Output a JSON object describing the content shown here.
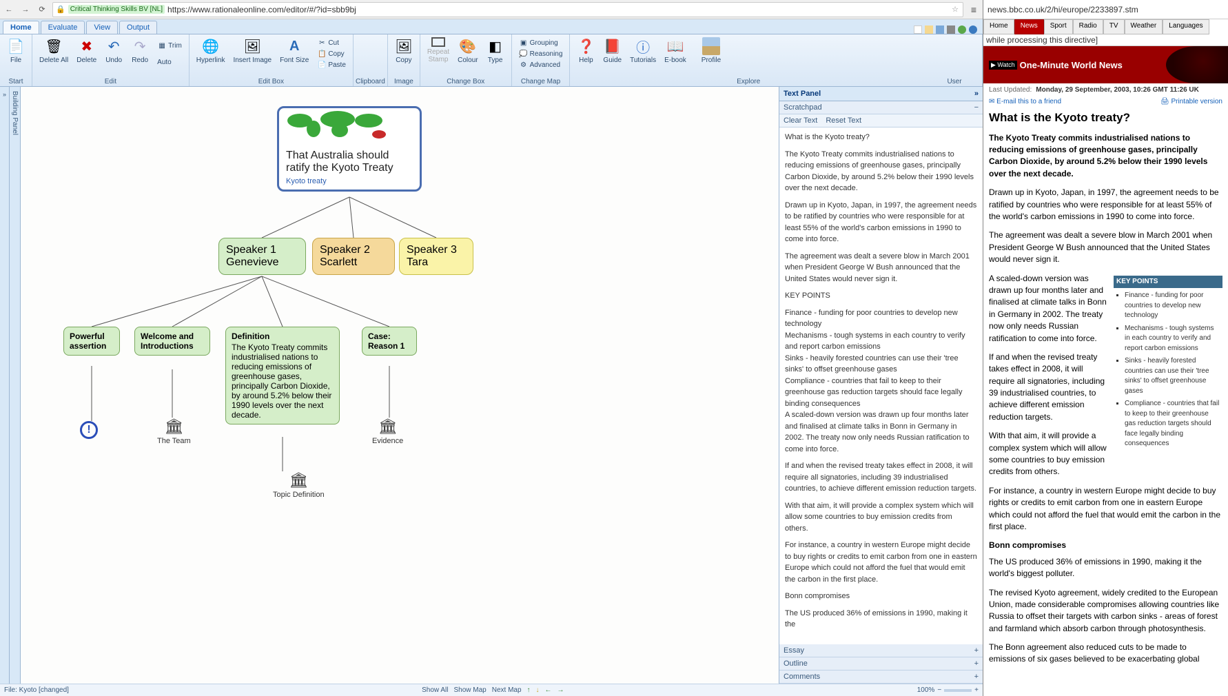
{
  "browser": {
    "ssl_label": "Critical Thinking Skills BV [NL]",
    "url": "https://www.rationaleonline.com/editor/#/?id=sbb9bj"
  },
  "tabs": [
    "Home",
    "Evaluate",
    "View",
    "Output"
  ],
  "ribbon": {
    "groups": [
      {
        "label": "Start",
        "items": [
          {
            "name": "File",
            "ico": "📄"
          }
        ]
      },
      {
        "label": "Edit",
        "items": [
          {
            "name": "Delete All",
            "ico": "🗑"
          },
          {
            "name": "Delete",
            "ico": "✖",
            "color": "#c00"
          },
          {
            "name": "Undo",
            "ico": "↶"
          },
          {
            "name": "Redo",
            "ico": "↷"
          },
          {
            "name": "Trim Box",
            "mini": true
          },
          {
            "name": "Auto",
            "mini": true
          }
        ]
      },
      {
        "label": "Edit Box",
        "items": [
          {
            "name": "Hyperlink",
            "ico": "🌐"
          },
          {
            "name": "Insert Image",
            "ico": "🖼"
          },
          {
            "name": "Font Size",
            "ico": "A"
          }
        ],
        "minis": [
          {
            "name": "Cut",
            "ico": "✂"
          },
          {
            "name": "Copy",
            "ico": "📋"
          },
          {
            "name": "Paste",
            "ico": "📄"
          }
        ]
      },
      {
        "label": "Clipboard",
        "items": []
      },
      {
        "label": "Image",
        "items": [
          {
            "name": "Copy",
            "ico": "🖼"
          }
        ]
      },
      {
        "label": "Change Box",
        "items": [
          {
            "name": "Repeat Stamp",
            "ico": "⬜"
          },
          {
            "name": "Colour",
            "ico": "🎨"
          },
          {
            "name": "Type",
            "ico": "◧"
          }
        ]
      },
      {
        "label": "Change Map",
        "items": [],
        "minis": [
          {
            "name": "Grouping",
            "ico": "▣"
          },
          {
            "name": "Reasoning",
            "ico": "💭"
          },
          {
            "name": "Advanced",
            "ico": "⚙"
          }
        ]
      },
      {
        "label": "Explore",
        "items": [
          {
            "name": "Help",
            "ico": "❓"
          },
          {
            "name": "Guide",
            "ico": "📕"
          },
          {
            "name": "Tutorials",
            "ico": "ⓘ"
          },
          {
            "name": "E-book",
            "ico": "📖"
          },
          {
            "name": "Profile",
            "ico": "👤"
          }
        ]
      },
      {
        "label": "User",
        "items": []
      }
    ]
  },
  "building_panel": "Building Panel",
  "map": {
    "main": {
      "title": "That Australia should ratify the Kyoto Treaty",
      "link": "Kyoto treaty"
    },
    "speakers": [
      {
        "label": "Speaker 1 Genevieve"
      },
      {
        "label": "Speaker 2 Scarlett"
      },
      {
        "label": "Speaker 3 Tara"
      }
    ],
    "subs": {
      "powerful": {
        "hd": "Powerful assertion"
      },
      "welcome": {
        "hd": "Welcome and Introductions"
      },
      "definition": {
        "hd": "Definition",
        "bd": "The Kyoto Treaty commits industrialised nations to reducing emissions of greenhouse gases, principally Carbon Dioxide, by around 5.2% below their 1990 levels over the next decade."
      },
      "case": {
        "hd": "Case: Reason 1"
      }
    },
    "leaves": {
      "team": "The Team",
      "evidence": "Evidence",
      "topic": "Topic Definition"
    }
  },
  "text_panel": {
    "title": "Text Panel",
    "scratchpad": "Scratchpad",
    "clear": "Clear Text",
    "reset": "Reset Text",
    "paragraphs": [
      "What is the Kyoto treaty?",
      "The Kyoto Treaty commits industrialised nations to reducing emissions of greenhouse gases, principally Carbon Dioxide, by around 5.2% below their 1990 levels over the next decade.",
      "Drawn up in Kyoto, Japan, in 1997, the agreement needs to be ratified by countries who were responsible for at least 55% of the world's carbon emissions in 1990 to come into force.",
      "The agreement was dealt a severe blow in March 2001 when President George W Bush announced that the United States would never sign it.",
      "KEY POINTS",
      "Finance - funding for poor countries to develop new technology",
      "Mechanisms - tough systems in each country to verify and report carbon emissions",
      "Sinks - heavily forested countries can use their 'tree sinks' to offset greenhouse gases",
      "Compliance - countries that fail to keep to their greenhouse gas reduction targets should face legally binding consequences",
      "A scaled-down version was drawn up four months later and finalised at climate talks in Bonn in Germany in 2002. The treaty now only needs Russian ratification to come into force.",
      "If and when the revised treaty takes effect in 2008, it will require all signatories, including 39 industrialised countries, to achieve different emission reduction targets.",
      "With that aim, it will provide a complex system which will allow some countries to buy emission credits from others.",
      "For instance, a country in western Europe might decide to buy rights or credits to emit carbon from one in eastern Europe which could not afford the fuel that would emit the carbon in the first place.",
      "Bonn compromises",
      "The US produced 36% of emissions in 1990, making it the"
    ],
    "sections": [
      "Essay",
      "Outline",
      "Comments"
    ]
  },
  "footer": {
    "file": "File: Kyoto [changed]",
    "buttons": [
      "Show All",
      "Show Map",
      "Next Map"
    ],
    "zoom": "100%"
  },
  "bbc": {
    "url": "news.bbc.co.uk/2/hi/europe/2233897.stm",
    "nav": [
      "Home",
      "News",
      "Sport",
      "Radio",
      "TV",
      "Weather",
      "Languages"
    ],
    "err": "while processing this directive]",
    "banner_watch": "▶ Watch",
    "banner_title": "One-Minute World News",
    "updated_label": "Last Updated:",
    "updated": "Monday, 29 September, 2003, 10:26 GMT 11:26 UK",
    "email": "E-mail this to a friend",
    "print": "Printable version",
    "headline": "What is the Kyoto treaty?",
    "paragraphs": [
      "The Kyoto Treaty commits industrialised nations to reducing emissions of greenhouse gases, principally Carbon Dioxide, by around 5.2% below their 1990 levels over the next decade.",
      "Drawn up in Kyoto, Japan, in 1997, the agreement needs to be ratified by countries who were responsible for at least 55% of the world's carbon emissions in 1990 to come into force.",
      "The agreement was dealt a severe blow in March 2001 when President George W Bush announced that the United States would never sign it.",
      "A scaled-down version was drawn up four months later and finalised at climate talks in Bonn in Germany in 2002. The treaty now only needs Russian ratification to come into force.",
      "If and when the revised treaty takes effect in 2008, it will require all signatories, including 39 industrialised countries, to achieve different emission reduction targets.",
      "With that aim, it will provide a complex system which will allow some countries to buy emission credits from others.",
      "For instance, a country in western Europe might decide to buy rights or credits to emit carbon from one in eastern Europe which could not afford the fuel that would emit the carbon in the first place."
    ],
    "keypoints_title": "KEY POINTS",
    "keypoints": [
      "Finance - funding for poor countries to develop new technology",
      "Mechanisms - tough systems in each country to verify and report carbon emissions",
      "Sinks - heavily forested countries can use their 'tree sinks' to offset greenhouse gases",
      "Compliance - countries that fail to keep to their greenhouse gas reduction targets should face legally binding consequences"
    ],
    "bonn_head": "Bonn compromises",
    "bonn_paras": [
      "The US produced 36% of emissions in 1990, making it the world's biggest polluter.",
      "The revised Kyoto agreement, widely credited to the European Union, made considerable compromises allowing countries like Russia to offset their targets with carbon sinks - areas of forest and farmland which absorb carbon through photosynthesis.",
      "The Bonn agreement also reduced cuts to be made to emissions of six gases believed to be exacerbating global"
    ]
  }
}
